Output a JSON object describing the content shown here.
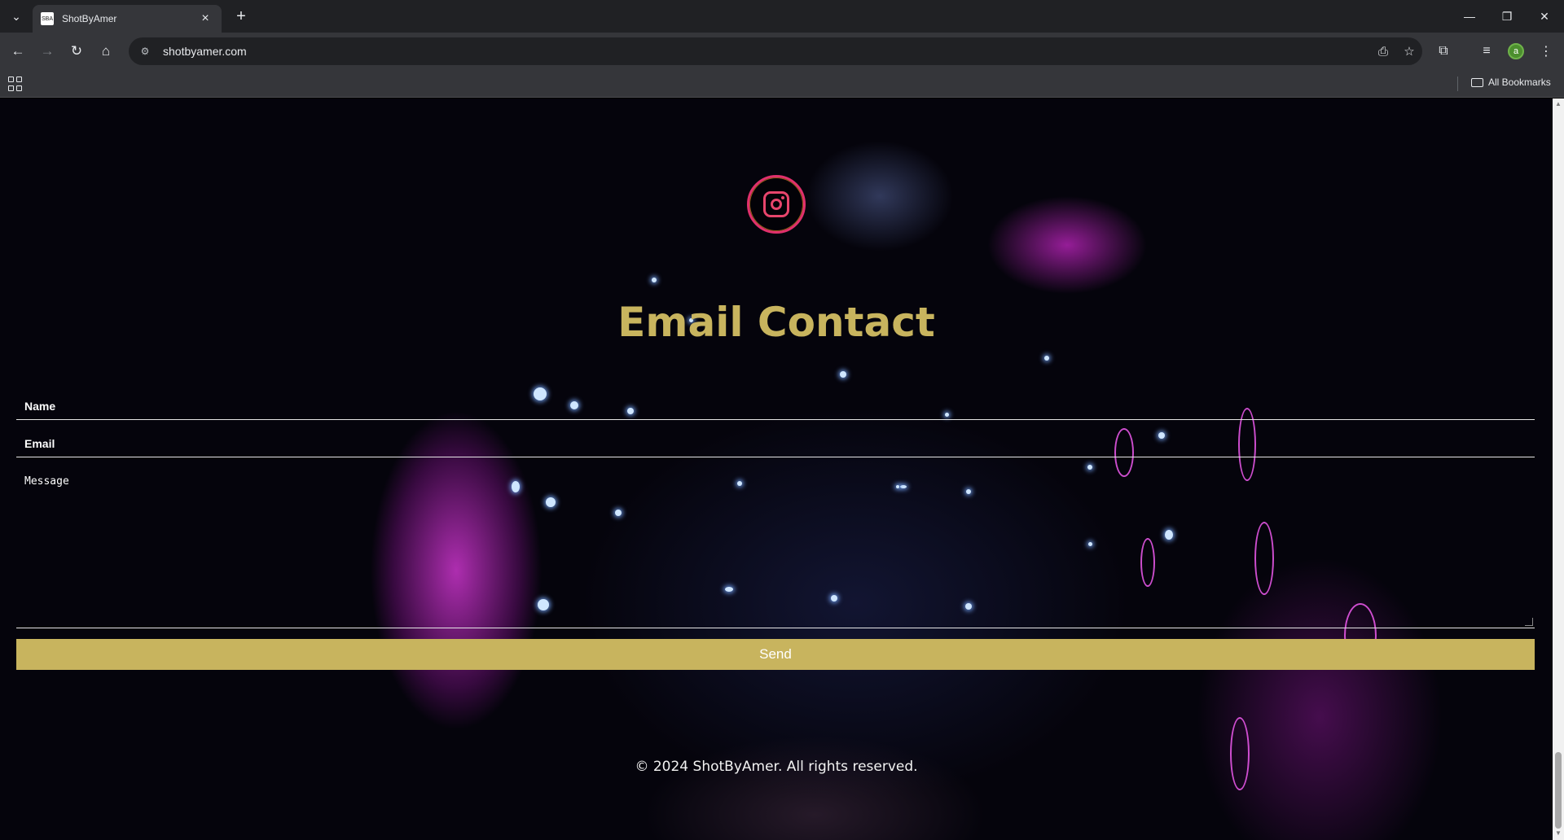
{
  "browser": {
    "tab_title": "ShotByAmer",
    "tab_favicon_text": "SBA",
    "url": "shotbyamer.com",
    "bookmarks_label": "All Bookmarks",
    "profile_initial": "a"
  },
  "page": {
    "social_icon": "instagram-icon",
    "section_title": "Email Contact",
    "form": {
      "name_label": "Name",
      "email_label": "Email",
      "message_placeholder": "Message",
      "send_label": "Send"
    },
    "footer": "© 2024 ShotByAmer. All rights reserved."
  },
  "colors": {
    "accent_gold": "#c8b45e",
    "instagram_pink": "#e1306c",
    "background": "#05040c"
  }
}
